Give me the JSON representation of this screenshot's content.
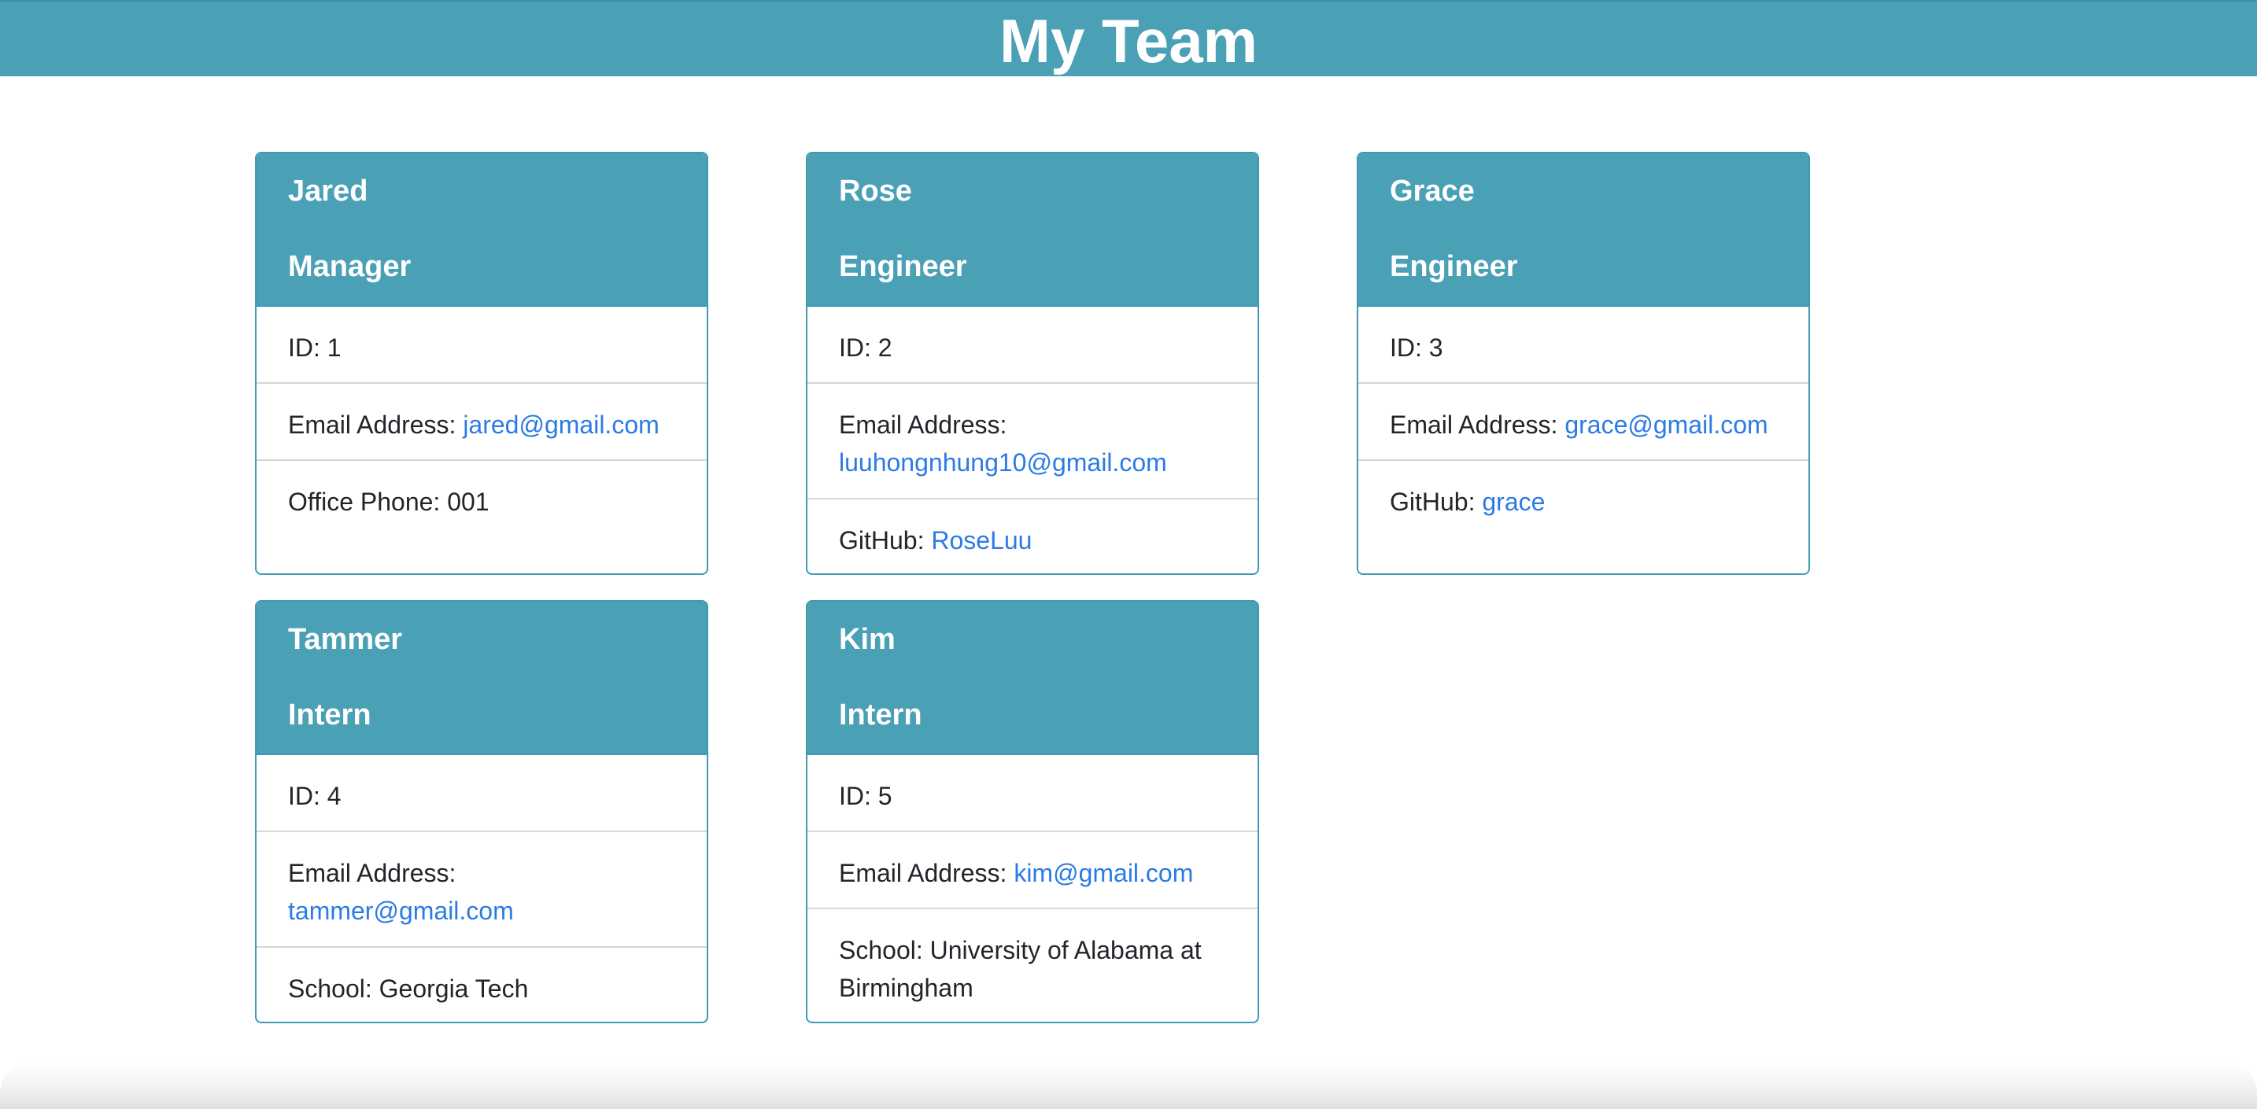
{
  "page": {
    "title": "My Team"
  },
  "team": [
    {
      "name": "Jared",
      "role": "Manager",
      "id_label": "ID: 1",
      "email_label": "Email Address: ",
      "email": "jared@gmail.com",
      "extra_label": "Office Phone: 001",
      "extra_value": ""
    },
    {
      "name": "Rose",
      "role": "Engineer",
      "id_label": "ID: 2",
      "email_label": "Email Address: ",
      "email": "luuhongnhung10@gmail.com",
      "extra_label": "GitHub: ",
      "extra_value": "RoseLuu"
    },
    {
      "name": "Grace",
      "role": "Engineer",
      "id_label": "ID: 3",
      "email_label": "Email Address: ",
      "email": "grace@gmail.com",
      "extra_label": "GitHub: ",
      "extra_value": "grace"
    },
    {
      "name": "Tammer",
      "role": "Intern",
      "id_label": "ID: 4",
      "email_label": "Email Address: ",
      "email": "tammer@gmail.com",
      "extra_label": "School: Georgia Tech",
      "extra_value": ""
    },
    {
      "name": "Kim",
      "role": "Intern",
      "id_label": "ID: 5",
      "email_label": "Email Address: ",
      "email": "kim@gmail.com",
      "extra_label": "School: University of Alabama at Birmingham",
      "extra_value": ""
    }
  ],
  "colors": {
    "accent": "#4aa0b5",
    "link": "#2b7be5",
    "border": "#3f99b3"
  }
}
